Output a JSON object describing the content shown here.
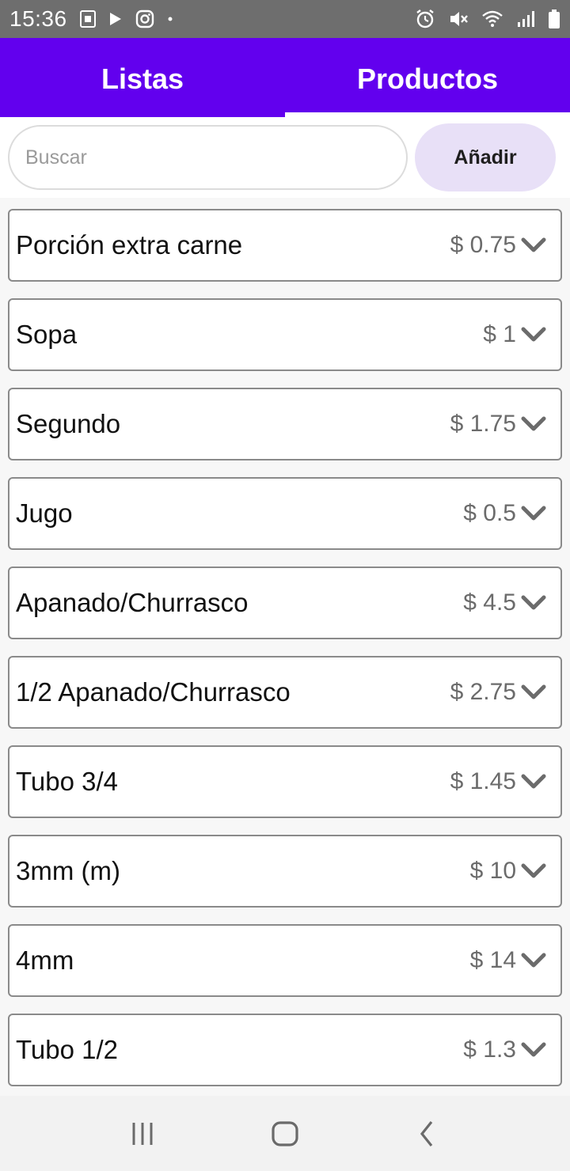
{
  "status_bar": {
    "time": "15:36",
    "icons_left": [
      "sim-icon",
      "play-icon",
      "instagram-icon",
      "dot-icon"
    ],
    "icons_right": [
      "alarm-icon",
      "mute-icon",
      "wifi-icon",
      "signal-icon",
      "battery-icon"
    ]
  },
  "tabs": [
    {
      "label": "Listas",
      "selected": false
    },
    {
      "label": "Productos",
      "selected": true
    }
  ],
  "search": {
    "placeholder": "Buscar",
    "value": ""
  },
  "add_button": {
    "label": "Añadir"
  },
  "products": [
    {
      "name": "Porción extra carne",
      "price": "$ 0.75"
    },
    {
      "name": "Sopa",
      "price": "$ 1"
    },
    {
      "name": "Segundo",
      "price": "$ 1.75"
    },
    {
      "name": "Jugo",
      "price": "$ 0.5"
    },
    {
      "name": "Apanado/Churrasco",
      "price": "$ 4.5"
    },
    {
      "name": "1/2 Apanado/Churrasco",
      "price": "$ 2.75"
    },
    {
      "name": "Tubo 3/4",
      "price": "$ 1.45"
    },
    {
      "name": "3mm (m)",
      "price": "$ 10"
    },
    {
      "name": "4mm",
      "price": "$ 14"
    },
    {
      "name": "Tubo 1/2",
      "price": "$ 1.3"
    }
  ],
  "nav_bar": {
    "buttons": [
      "recent-apps-icon",
      "home-icon",
      "back-icon"
    ]
  },
  "colors": {
    "accent": "#6200ee",
    "status_bar": "#6e6e6e",
    "add_button_bg": "#e8e0f7"
  }
}
